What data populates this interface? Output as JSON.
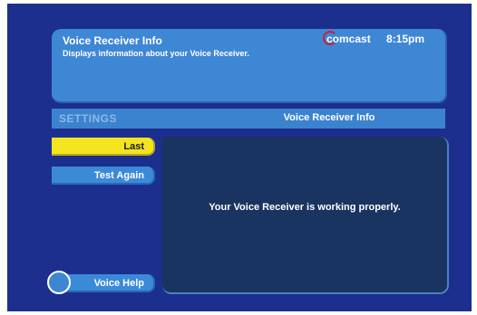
{
  "header": {
    "title": "Voice Receiver Info",
    "description": "Displays information about your Voice Receiver.",
    "brand": "comcast",
    "time": "8:15pm"
  },
  "settings_bar": {
    "label": "SETTINGS",
    "section_title": "Voice Receiver Info"
  },
  "buttons": {
    "last": "Last",
    "test_again": "Test Again",
    "voice_help": "Voice Help"
  },
  "content": {
    "message": "Your Voice Receiver is working properly."
  },
  "colors": {
    "background": "#1c2f8e",
    "panel": "#3e87d4",
    "highlight": "#f4e41e",
    "content_panel": "#193460"
  }
}
